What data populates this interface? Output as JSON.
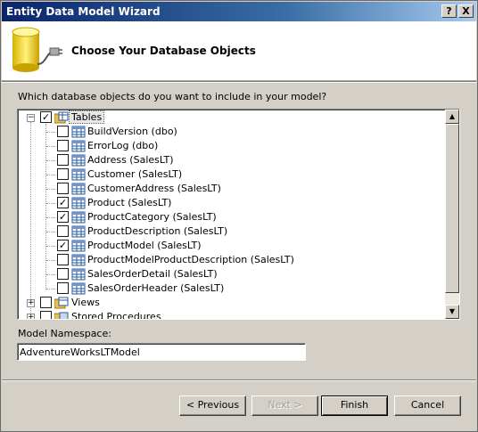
{
  "window": {
    "title": "Entity Data Model Wizard",
    "help_btn": "?",
    "close_btn": "X"
  },
  "header": {
    "title": "Choose Your Database Objects"
  },
  "question": "Which database objects do you want to include in your model?",
  "tree": {
    "tables": {
      "label": "Tables",
      "expanded": true,
      "checked": true
    },
    "items": [
      {
        "label": "BuildVersion (dbo)",
        "checked": false
      },
      {
        "label": "ErrorLog (dbo)",
        "checked": false
      },
      {
        "label": "Address (SalesLT)",
        "checked": false
      },
      {
        "label": "Customer (SalesLT)",
        "checked": false
      },
      {
        "label": "CustomerAddress (SalesLT)",
        "checked": false
      },
      {
        "label": "Product (SalesLT)",
        "checked": true
      },
      {
        "label": "ProductCategory (SalesLT)",
        "checked": true
      },
      {
        "label": "ProductDescription (SalesLT)",
        "checked": false
      },
      {
        "label": "ProductModel (SalesLT)",
        "checked": true
      },
      {
        "label": "ProductModelProductDescription (SalesLT)",
        "checked": false
      },
      {
        "label": "SalesOrderDetail (SalesLT)",
        "checked": false
      },
      {
        "label": "SalesOrderHeader (SalesLT)",
        "checked": false
      }
    ],
    "views": {
      "label": "Views",
      "checked": false
    },
    "procs": {
      "label": "Stored Procedures",
      "checked": false
    },
    "expand_minus": "−",
    "expand_plus": "+",
    "check_mark": "✓"
  },
  "namespace": {
    "label": "Model Namespace:",
    "value": "AdventureWorksLTModel"
  },
  "buttons": {
    "previous": "< Previous",
    "next": "Next >",
    "finish": "Finish",
    "cancel": "Cancel"
  },
  "scroll": {
    "up": "▲",
    "down": "▼"
  }
}
